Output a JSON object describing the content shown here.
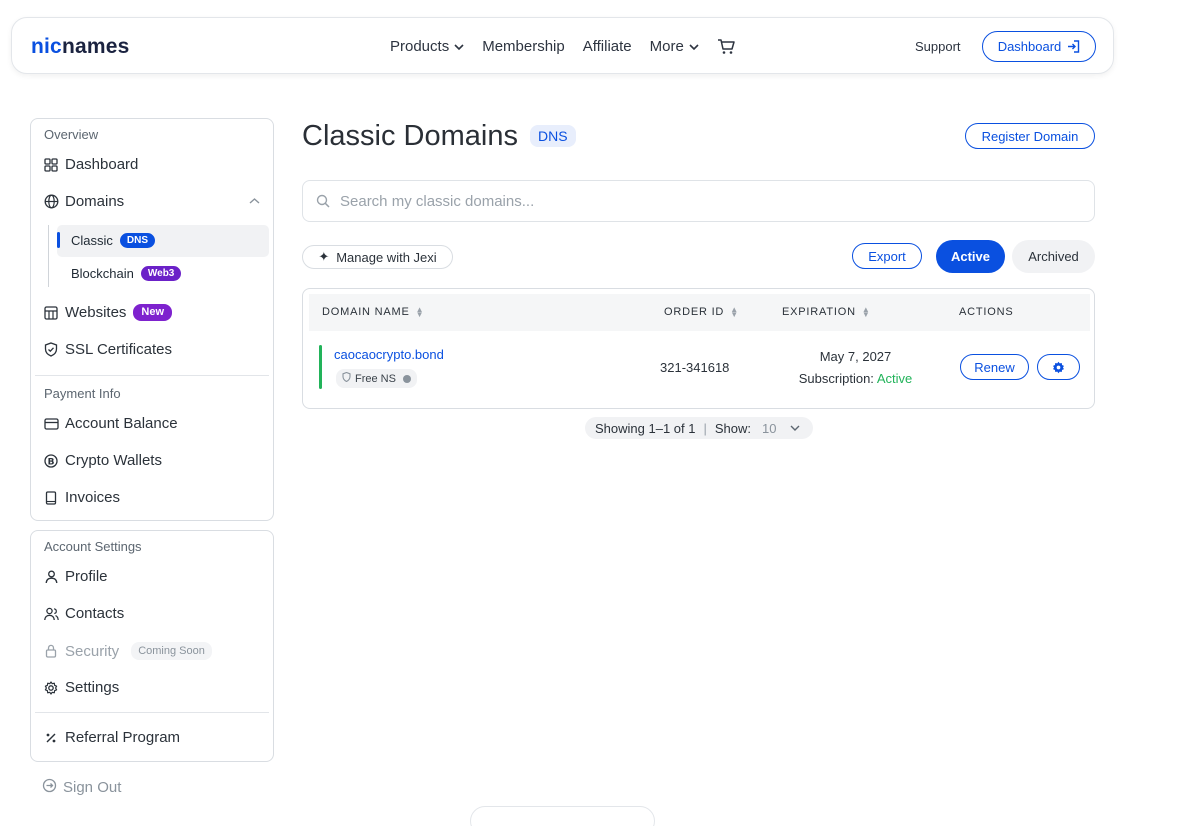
{
  "header": {
    "logo_accent": "nic",
    "logo_rest": "names",
    "nav": {
      "products": "Products",
      "membership": "Membership",
      "affiliate": "Affiliate",
      "more": "More"
    },
    "support": "Support",
    "dashboard_button": "Dashboard"
  },
  "sidebar": {
    "overview_label": "Overview",
    "dashboard": "Dashboard",
    "domains": "Domains",
    "classic": "Classic",
    "classic_badge": "DNS",
    "blockchain": "Blockchain",
    "blockchain_badge": "Web3",
    "websites": "Websites",
    "websites_badge": "New",
    "ssl": "SSL Certificates",
    "payment_label": "Payment Info",
    "account_balance": "Account Balance",
    "crypto_wallets": "Crypto Wallets",
    "invoices": "Invoices",
    "account_settings_label": "Account Settings",
    "profile": "Profile",
    "contacts": "Contacts",
    "security": "Security",
    "security_badge": "Coming Soon",
    "settings": "Settings",
    "referral": "Referral Program",
    "sign_out": "Sign Out"
  },
  "main": {
    "title": "Classic Domains",
    "title_badge": "DNS",
    "register_button": "Register Domain",
    "search_placeholder": "Search my classic domains...",
    "jexi_button": "Manage with Jexi",
    "export_button": "Export",
    "active_tab": "Active",
    "archived_tab": "Archived",
    "table": {
      "columns": {
        "domain": "DOMAIN NAME",
        "order": "ORDER ID",
        "expiration": "EXPIRATION",
        "actions": "ACTIONS"
      },
      "rows": [
        {
          "domain": "caocaocrypto.bond",
          "ns_badge": "Free NS",
          "order_id": "321-341618",
          "expiration": "May 7, 2027",
          "subscription_label": "Subscription:",
          "subscription_status": "Active",
          "renew": "Renew"
        }
      ]
    },
    "pager": {
      "showing": "Showing 1–1 of 1",
      "show_label": "Show:",
      "page_size": "10"
    }
  },
  "colors": {
    "accent": "#0a50e0",
    "success": "#22b35a",
    "purple": "#7e22ce"
  },
  "icons": [
    "cart-icon",
    "chevron-down-icon",
    "login-icon",
    "grid-icon",
    "globe-icon",
    "chevron-up-icon",
    "website-icon",
    "shield-check-icon",
    "card-icon",
    "bitcoin-icon",
    "book-icon",
    "user-icon",
    "users-icon",
    "lock-icon",
    "gear-icon",
    "percent-icon",
    "sign-out-icon",
    "search-icon",
    "sparkle-icon",
    "sort-icon",
    "shield-icon",
    "info-icon"
  ]
}
